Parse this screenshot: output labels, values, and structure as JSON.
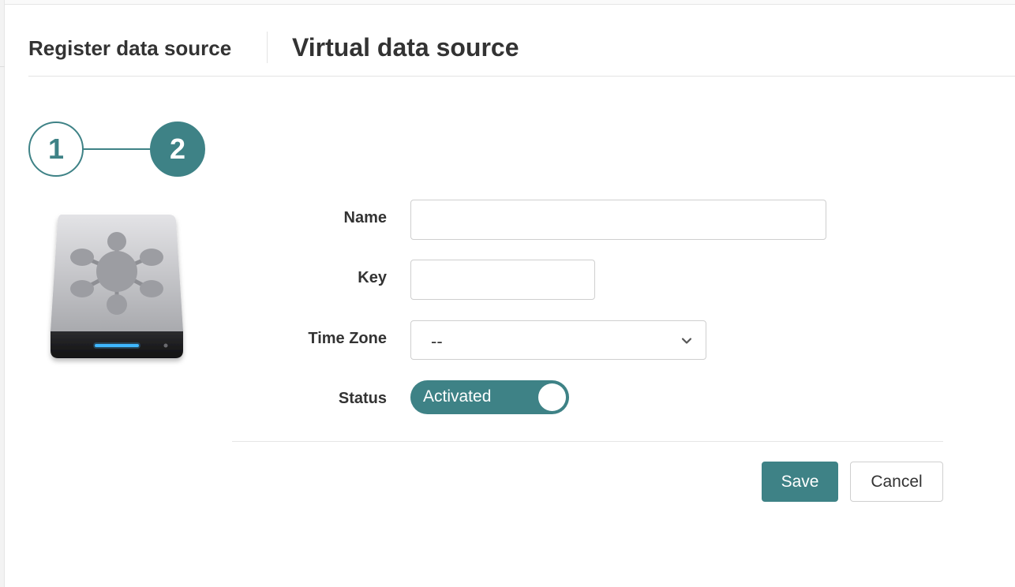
{
  "header": {
    "breadcrumb": "Register data source",
    "title": "Virtual data source"
  },
  "steps": [
    {
      "number": "1",
      "state": "completed"
    },
    {
      "number": "2",
      "state": "current"
    }
  ],
  "drive_icon": {
    "name": "network-drive-icon"
  },
  "form": {
    "name": {
      "label": "Name",
      "value": "",
      "placeholder": ""
    },
    "key": {
      "label": "Key",
      "value": "",
      "placeholder": ""
    },
    "time_zone": {
      "label": "Time Zone",
      "selected": "--"
    },
    "status": {
      "label": "Status",
      "value": "Activated",
      "on": true
    }
  },
  "actions": {
    "save_label": "Save",
    "cancel_label": "Cancel"
  },
  "colors": {
    "accent": "#3e8286",
    "border": "#cfcfcf",
    "text": "#333333"
  }
}
